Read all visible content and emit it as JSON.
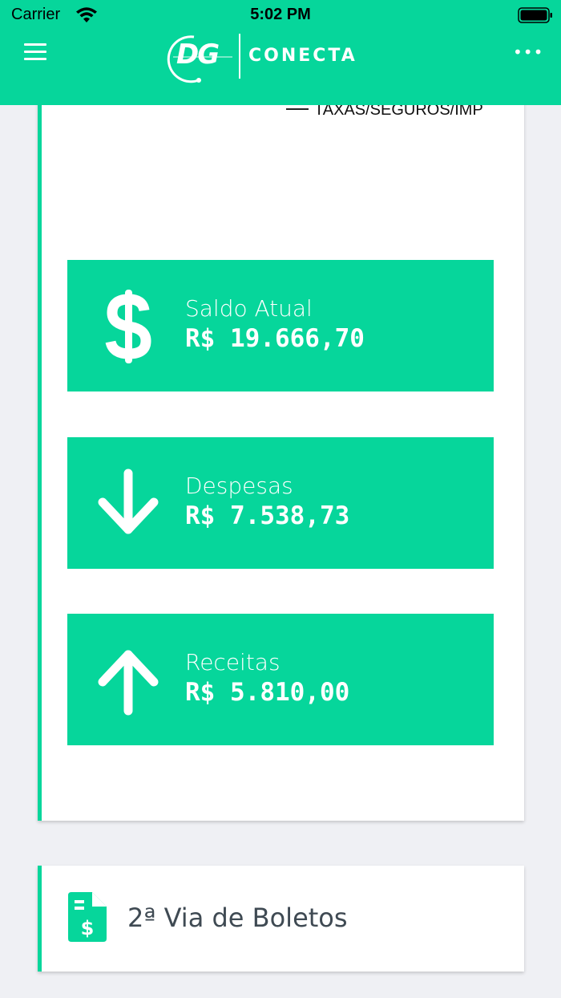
{
  "status_bar": {
    "carrier": "Carrier",
    "time": "5:02 PM",
    "icons": [
      "wifi-icon",
      "battery-icon"
    ]
  },
  "nav": {
    "logo_mark": "DG",
    "logo_text": "CONECTA",
    "menu_icon": "hamburger-icon",
    "more_icon": "more-dots-icon",
    "more_glyph": "•••"
  },
  "chart_legend": {
    "label": "TAXAS/SEGUROS/IMP"
  },
  "summary": {
    "tiles": [
      {
        "icon": "dollar-icon",
        "label": "Saldo Atual",
        "value": "R$ 19.666,70"
      },
      {
        "icon": "arrow-down-icon",
        "label": "Despesas",
        "value": "R$ 7.538,73"
      },
      {
        "icon": "arrow-up-icon",
        "label": "Receitas",
        "value": "R$ 5.810,00"
      }
    ]
  },
  "boletos": {
    "icon": "invoice-icon",
    "label": "2ª Via de Boletos"
  },
  "colors": {
    "accent": "#06d69b",
    "background": "#eff0f4",
    "card": "#ffffff",
    "boleto_text": "#3f4a53"
  }
}
